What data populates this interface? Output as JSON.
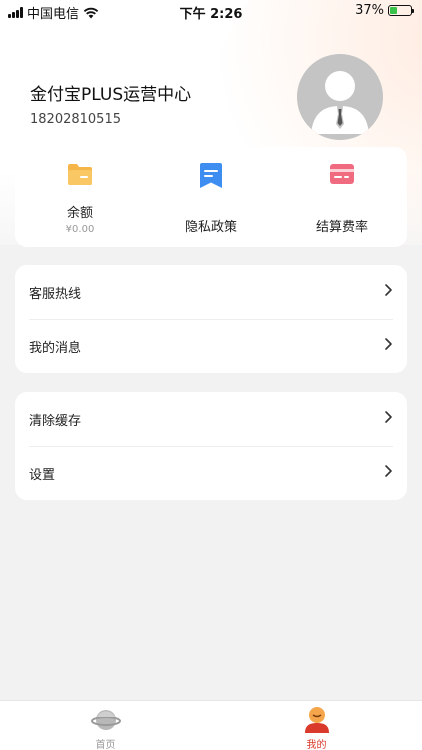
{
  "status_bar": {
    "carrier": "中国电信",
    "time": "下午 2:26",
    "battery_percent": "37%",
    "battery_level": 0.37,
    "icons": [
      "signal-icon",
      "wifi-icon",
      "battery-icon"
    ]
  },
  "profile": {
    "name": "金付宝PLUS运营中心",
    "phone": "18202810515",
    "avatar_icon": "user-avatar-icon"
  },
  "quick_actions": [
    {
      "label": "余额",
      "sub": "¥0.00",
      "icon": "folder-icon",
      "color": "#f5b547"
    },
    {
      "label": "隐私政策",
      "icon": "bookmark-icon",
      "color": "#3d8ef0"
    },
    {
      "label": "结算费率",
      "icon": "card-icon",
      "color": "#f06a80"
    }
  ],
  "menu_group_1": [
    {
      "label": "客服热线"
    },
    {
      "label": "我的消息"
    }
  ],
  "menu_group_2": [
    {
      "label": "清除缓存"
    },
    {
      "label": "设置"
    }
  ],
  "tabbar": {
    "tabs": [
      {
        "label": "首页",
        "icon": "planet-icon",
        "active": false
      },
      {
        "label": "我的",
        "icon": "user-profile-icon",
        "active": true
      }
    ],
    "active_color": "#d93a2b",
    "inactive_color": "#999999"
  }
}
